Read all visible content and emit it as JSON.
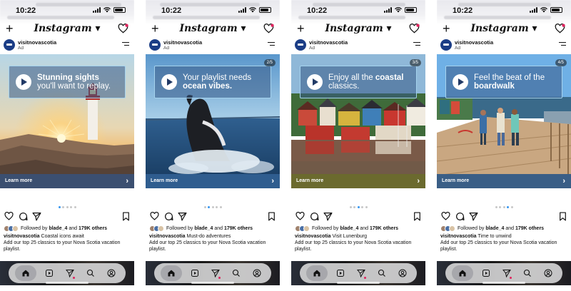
{
  "status": {
    "time": "10:22"
  },
  "app": {
    "title": "Instagram"
  },
  "post": {
    "account": "visitnovascotia",
    "ad_label": "Ad",
    "followed_by_prefix": "Followed by",
    "followed_user": "blade_4",
    "followed_and": "and",
    "followed_count": "179K others",
    "caption_body": "Add our top 25 classics to your Nova Scotia vacation playlist.",
    "learn_more": "Learn more"
  },
  "slides": [
    {
      "counter": "",
      "headline_bold": "Stunning sights",
      "headline_rest": "you'll want to replay.",
      "caption_title": "Coastal icons await",
      "learn_bar_color": "#3b4f70",
      "active_dot": 0
    },
    {
      "counter": "2/5",
      "headline_rest": "Your playlist needs",
      "headline_bold": "ocean vibes.",
      "caption_title": "Must-do adventures",
      "learn_bar_color": "#2f5d8f",
      "active_dot": 1
    },
    {
      "counter": "3/5",
      "headline_rest": "Enjoy all the",
      "headline_bold": "coastal",
      "headline_tail": "classics.",
      "caption_title": "Visit Lunenburg",
      "learn_bar_color": "#6b6a2e",
      "active_dot": 2
    },
    {
      "counter": "4/5",
      "headline_rest": "Feel the beat of the",
      "headline_bold": "boardwalk",
      "caption_title": "Time to unwind",
      "learn_bar_color": "#3a5e86",
      "active_dot": 3
    }
  ],
  "icons": {
    "plus": "plus-icon",
    "heart": "heart-icon",
    "comment": "comment-icon",
    "share": "share-icon",
    "bookmark": "bookmark-icon",
    "tabs": [
      "home-icon",
      "reels-icon",
      "send-icon",
      "search-icon",
      "profile-icon"
    ]
  },
  "colors": {
    "accent_dot": "#3897f0",
    "notification": "#e0245e",
    "banner_border": "#aad7f0"
  }
}
